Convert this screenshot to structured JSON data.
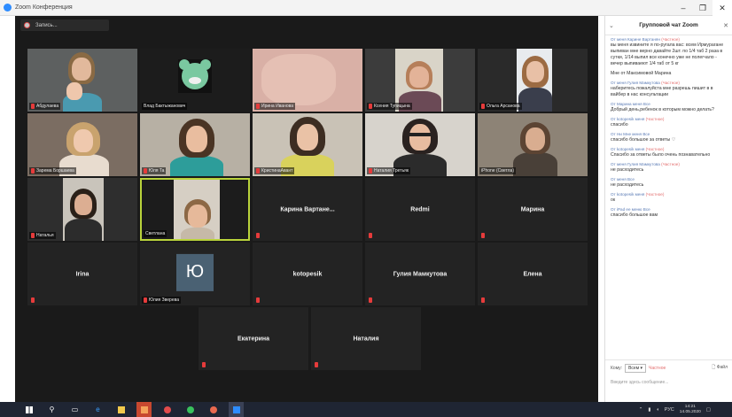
{
  "window": {
    "title": "Zoom Конференция"
  },
  "recording": {
    "label": "Запись..."
  },
  "tiles": [
    {
      "name": "Абдулаева"
    },
    {
      "name": "Влад Бактыжанович"
    },
    {
      "name": "Ирина Иванова"
    },
    {
      "name": "Ксения Тупицына"
    },
    {
      "name": "Ольга Арсанова"
    },
    {
      "name": "Зарема Боршаева"
    },
    {
      "name": "Юля Та"
    },
    {
      "name": "КристинаАвант"
    },
    {
      "name": "Наталия Третьяк"
    },
    {
      "name": "iPhone (Светла)"
    },
    {
      "name": "Наталья"
    },
    {
      "name": "Светлана"
    },
    {
      "name": "Карина Вартане..."
    },
    {
      "name": "Redmi"
    },
    {
      "name": "Марина"
    },
    {
      "name": "Irina"
    },
    {
      "name": "Юлия Зверева",
      "initial": "Ю"
    },
    {
      "name": "kotopesik"
    },
    {
      "name": "Гулия Мамкутова"
    },
    {
      "name": "Елена"
    },
    {
      "name": "Екатерина"
    },
    {
      "name": "Наталия"
    }
  ],
  "chat": {
    "title": "Групповой чат Zoom",
    "messages": [
      {
        "from": "От меня Карине Вартанян",
        "private": "(Частное)",
        "text": "вы меня извините я по-ругала вас: всем Ирмурагане выпиван мне верно давайте 2шт. по 1/4 таб 2 раза в сутки, 1/14 выпил все конечно уже не полегчало - вечер выпиваеют 1/4 таб от 5 кг"
      },
      {
        "from": "",
        "private": "",
        "text": "Мне от Максимовой Марина"
      },
      {
        "from": "От меня Гулия Мамкутова",
        "private": "(Частное)",
        "text": "наберитесь пожалуйста мне разрешь пишит в в вайбер в нас консультации"
      },
      {
        "from": "От Марина меня Все",
        "private": "",
        "text": "Добрый день,ребенок в которым можно делать?"
      },
      {
        "from": "От kotopesik меня",
        "private": "(Частное)",
        "text": "спасибо"
      },
      {
        "from": "От Ни Мне меня Все",
        "private": "",
        "text": "спасибо большое за ответы ♡"
      },
      {
        "from": "От kotopesik меня",
        "private": "(Частное)",
        "text": "Спасибо за ответы было очень познавательно"
      },
      {
        "from": "От меня Гулия Мамкутова",
        "private": "(Частное)",
        "text": "не расходитесь"
      },
      {
        "from": "От меня Все",
        "private": "",
        "text": "не расходитесь"
      },
      {
        "from": "От kotopesik меня",
        "private": "(Частное)",
        "text": "ок"
      },
      {
        "from": "От iPad ее меню Все",
        "private": "",
        "text": "спасибо большое вам"
      }
    ],
    "to_label": "Кому:",
    "to_value": "Всем ▾",
    "private_label": "Частное",
    "file_label": "Файл",
    "input_placeholder": "Введите здесь сообщение..."
  },
  "taskbar": {
    "tray_lang": "РУС",
    "time": "14:21",
    "date": "14.05.2020"
  },
  "colors": {
    "zoom_bg": "#1a1a1a",
    "tile_bg": "#232323",
    "active_border": "#b9d33b",
    "mic_muted": "#e63b3b",
    "taskbar": "#1f2533"
  }
}
